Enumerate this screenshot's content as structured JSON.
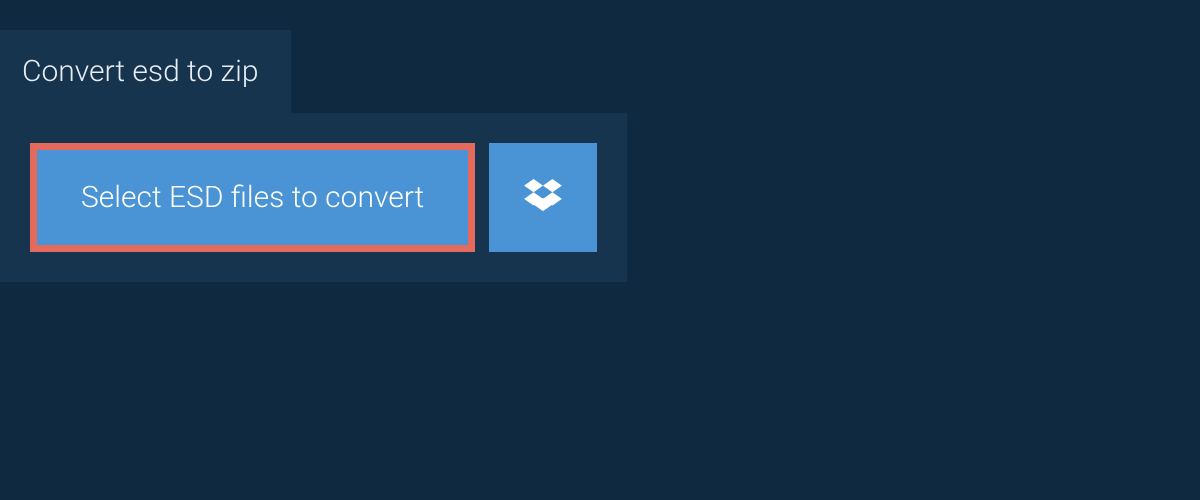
{
  "tab": {
    "title": "Convert esd to zip"
  },
  "actions": {
    "select_label": "Select ESD files to convert"
  },
  "colors": {
    "background": "#0f2940",
    "panel": "#16344e",
    "button": "#4a94d6",
    "highlight_border": "#e46a5e",
    "text_light": "#ffffff"
  }
}
